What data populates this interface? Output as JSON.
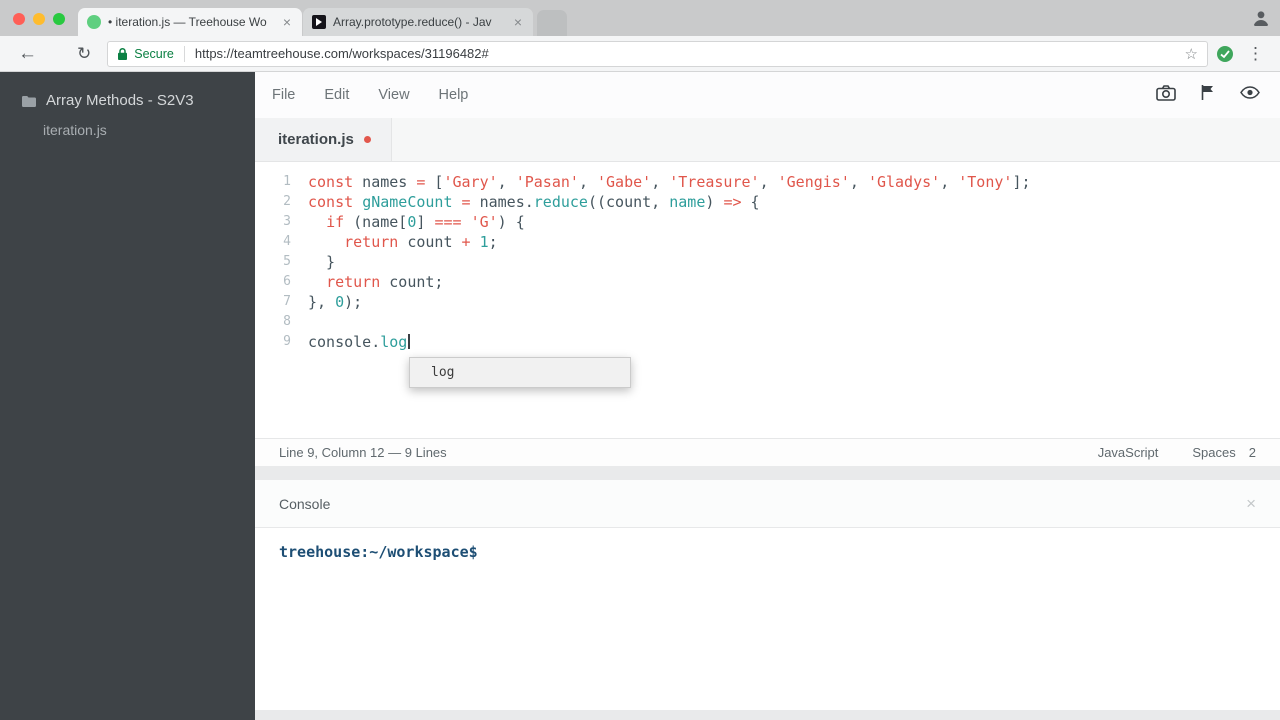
{
  "colors": {
    "treehouse_green": "#5fcf80",
    "secure_green": "#0b8043",
    "keyword_red": "#e0564b",
    "function_teal": "#2e9e9b",
    "code_plain": "#46555e",
    "prompt_blue": "#1d4e74",
    "sidebar_bg": "#3e4347",
    "modified_dot_red": "#e2574c"
  },
  "browser": {
    "tabs": [
      {
        "title": "• iteration.js — Treehouse Wo",
        "favicon": "treehouse",
        "active": true
      },
      {
        "title": "Array.prototype.reduce() - Jav",
        "favicon": "mdn",
        "active": false
      }
    ],
    "close_glyph": "×",
    "back_glyph": "←",
    "reload_glyph": "↻",
    "security_label": "Secure",
    "url": "https://teamtreehouse.com/workspaces/31196482#",
    "star_glyph": "☆",
    "menu_glyph": "⋮"
  },
  "sidebar": {
    "project": "Array Methods - S2V3",
    "files": [
      {
        "name": "iteration.js"
      }
    ]
  },
  "workspace": {
    "menu": [
      "File",
      "Edit",
      "View",
      "Help"
    ]
  },
  "editor": {
    "tab_name": "iteration.js",
    "lines": [
      {
        "number": 1,
        "tokens": [
          {
            "t": "kw",
            "v": "const"
          },
          {
            "t": "pln",
            "v": " names "
          },
          {
            "t": "op",
            "v": "="
          },
          {
            "t": "pln",
            "v": " ["
          },
          {
            "t": "str",
            "v": "'Gary'"
          },
          {
            "t": "pln",
            "v": ", "
          },
          {
            "t": "str",
            "v": "'Pasan'"
          },
          {
            "t": "pln",
            "v": ", "
          },
          {
            "t": "str",
            "v": "'Gabe'"
          },
          {
            "t": "pln",
            "v": ", "
          },
          {
            "t": "str",
            "v": "'Treasure'"
          },
          {
            "t": "pln",
            "v": ", "
          },
          {
            "t": "str",
            "v": "'Gengis'"
          },
          {
            "t": "pln",
            "v": ", "
          },
          {
            "t": "str",
            "v": "'Gladys'"
          },
          {
            "t": "pln",
            "v": ", "
          },
          {
            "t": "str",
            "v": "'Tony'"
          },
          {
            "t": "pln",
            "v": "];"
          }
        ]
      },
      {
        "number": 2,
        "tokens": [
          {
            "t": "kw",
            "v": "const"
          },
          {
            "t": "pln",
            "v": " "
          },
          {
            "t": "fn",
            "v": "gNameCount"
          },
          {
            "t": "pln",
            "v": " "
          },
          {
            "t": "op",
            "v": "="
          },
          {
            "t": "pln",
            "v": " names."
          },
          {
            "t": "fn",
            "v": "reduce"
          },
          {
            "t": "pln",
            "v": "((count, "
          },
          {
            "t": "fn",
            "v": "name"
          },
          {
            "t": "pln",
            "v": ") "
          },
          {
            "t": "op",
            "v": "=>"
          },
          {
            "t": "pln",
            "v": " {"
          }
        ]
      },
      {
        "number": 3,
        "tokens": [
          {
            "t": "pln",
            "v": "  "
          },
          {
            "t": "kw",
            "v": "if"
          },
          {
            "t": "pln",
            "v": " (name["
          },
          {
            "t": "num",
            "v": "0"
          },
          {
            "t": "pln",
            "v": "] "
          },
          {
            "t": "op",
            "v": "==="
          },
          {
            "t": "pln",
            "v": " "
          },
          {
            "t": "str",
            "v": "'G'"
          },
          {
            "t": "pln",
            "v": ") {"
          }
        ]
      },
      {
        "number": 4,
        "tokens": [
          {
            "t": "pln",
            "v": "    "
          },
          {
            "t": "kw",
            "v": "return"
          },
          {
            "t": "pln",
            "v": " count "
          },
          {
            "t": "op",
            "v": "+"
          },
          {
            "t": "pln",
            "v": " "
          },
          {
            "t": "num",
            "v": "1"
          },
          {
            "t": "pln",
            "v": ";"
          }
        ]
      },
      {
        "number": 5,
        "tokens": [
          {
            "t": "pln",
            "v": "  }"
          }
        ]
      },
      {
        "number": 6,
        "tokens": [
          {
            "t": "pln",
            "v": "  "
          },
          {
            "t": "kw",
            "v": "return"
          },
          {
            "t": "pln",
            "v": " count;"
          }
        ]
      },
      {
        "number": 7,
        "tokens": [
          {
            "t": "pln",
            "v": "}, "
          },
          {
            "t": "num",
            "v": "0"
          },
          {
            "t": "pln",
            "v": ");"
          }
        ]
      },
      {
        "number": 8,
        "tokens": []
      },
      {
        "number": 9,
        "cursor": true,
        "tokens": [
          {
            "t": "pln",
            "v": "console."
          },
          {
            "t": "fn",
            "v": "log"
          }
        ]
      }
    ],
    "autocomplete": [
      {
        "label": "log"
      }
    ],
    "status_left": "Line 9, Column 12 — 9 Lines",
    "status_language": "JavaScript",
    "status_indent_label": "Spaces",
    "status_indent_value": "2"
  },
  "console": {
    "title": "Console",
    "close_glyph": "×",
    "prompt": "treehouse:~/workspace$"
  }
}
